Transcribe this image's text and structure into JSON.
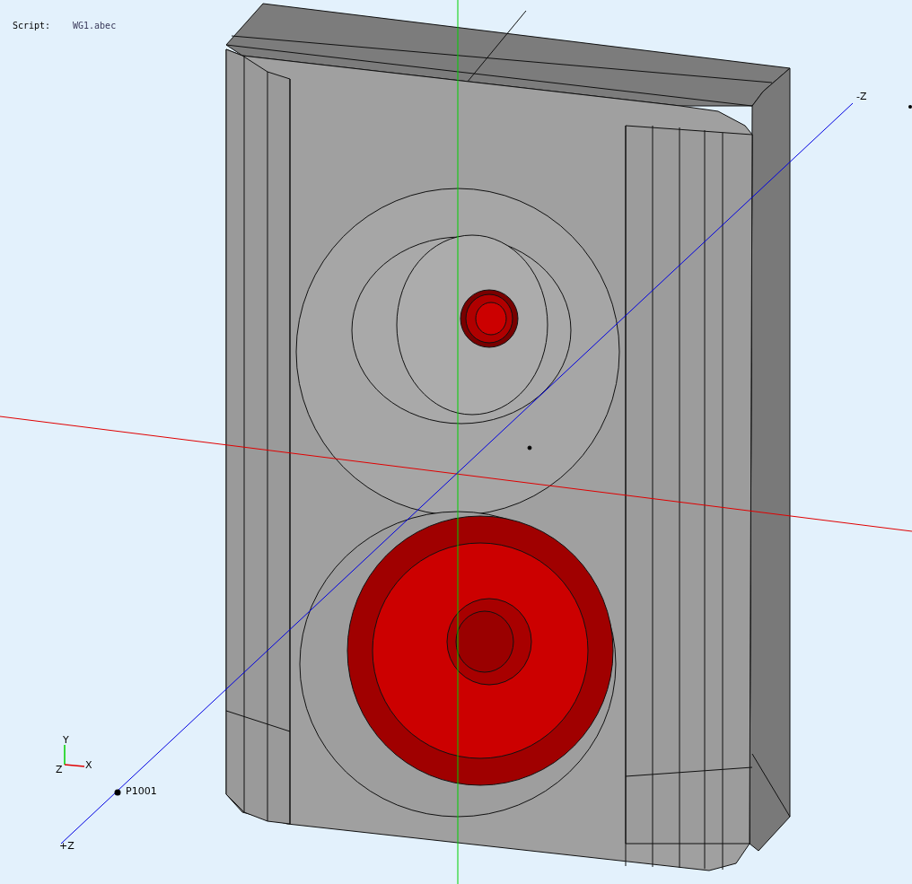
{
  "header": {
    "label": "Script:",
    "value": "WG1.abec"
  },
  "viewport": {
    "axis_labels": [
      {
        "kind": "neg",
        "text": "-Z"
      },
      {
        "kind": "pos",
        "text": "+Z"
      }
    ],
    "point": {
      "label": "P1001"
    },
    "triad": {
      "y_label": "Y",
      "z_label": "Z",
      "x_label": "X"
    }
  }
}
